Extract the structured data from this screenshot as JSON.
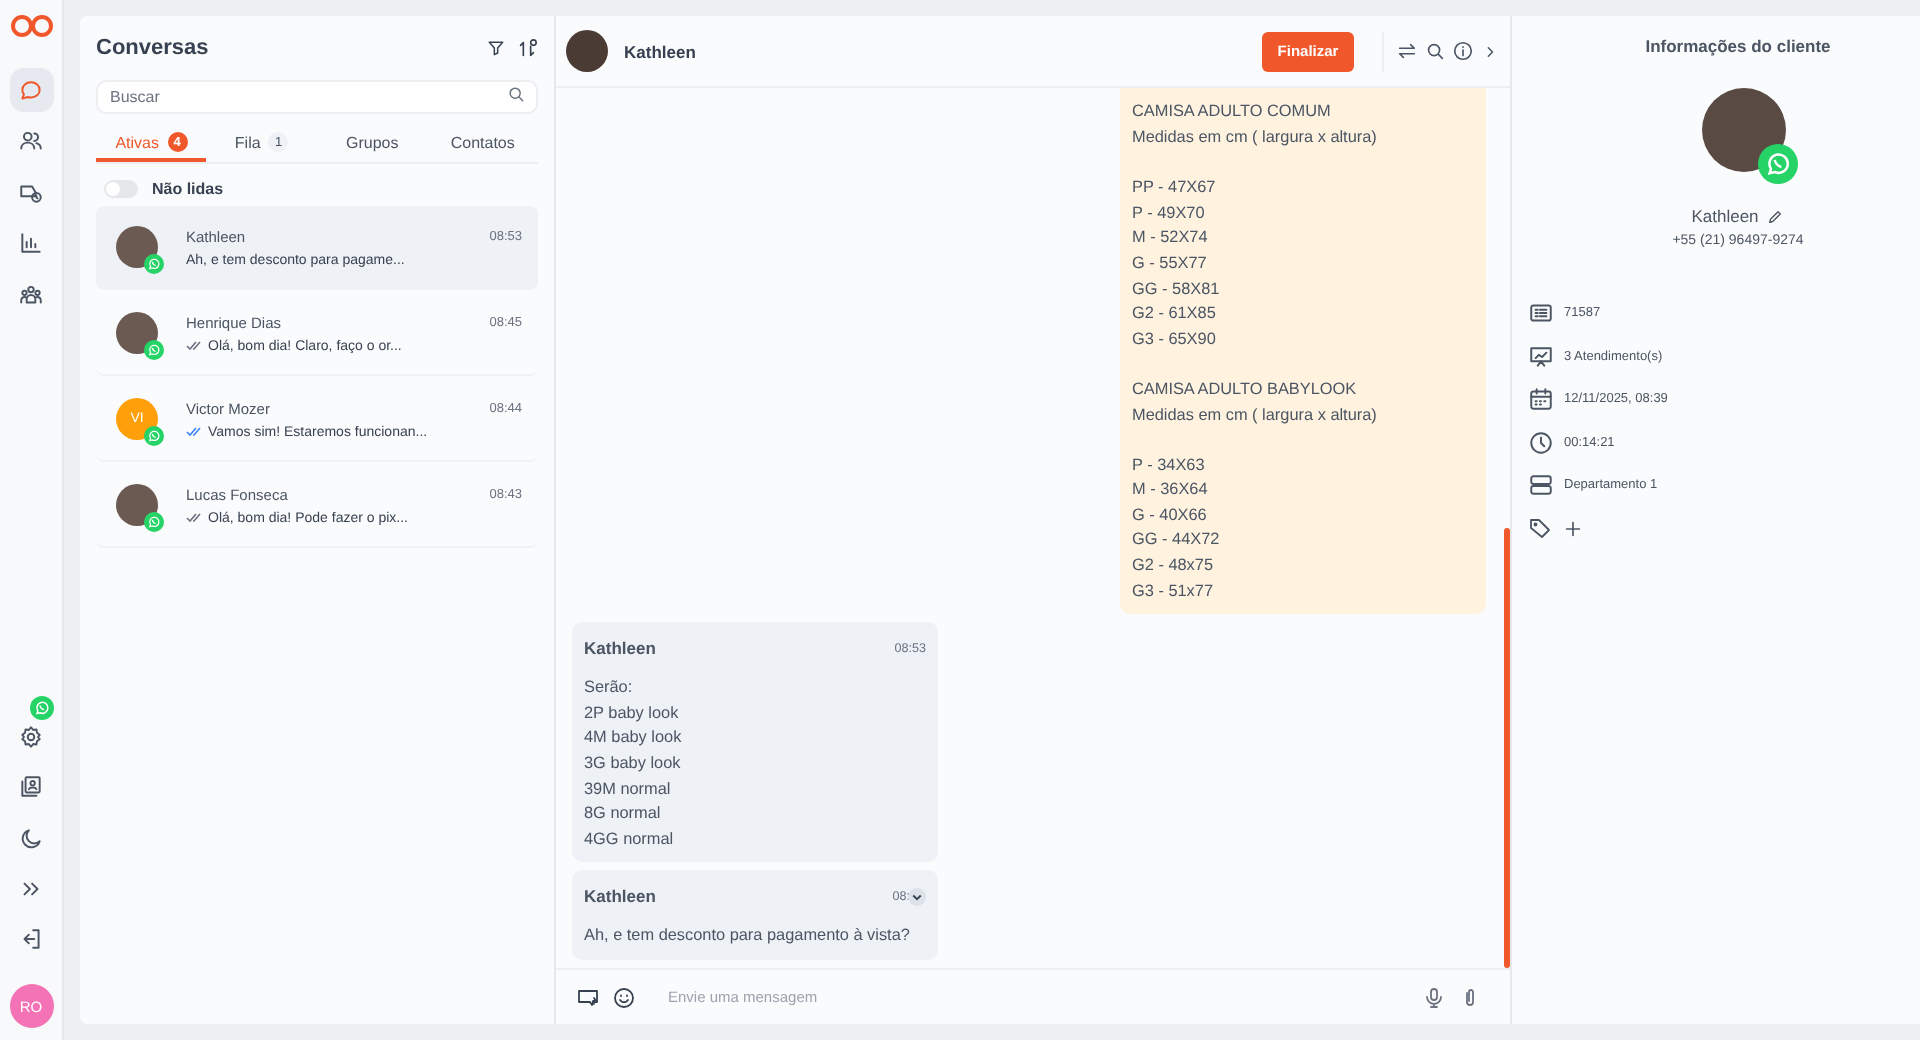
{
  "rail": {
    "items": [
      {
        "kind": "chat",
        "selected": true
      },
      {
        "kind": "contacts",
        "selected": false
      },
      {
        "kind": "queue",
        "selected": false
      },
      {
        "kind": "reports",
        "selected": false
      },
      {
        "kind": "teams",
        "selected": false
      }
    ],
    "bottom": [
      {
        "kind": "settings"
      },
      {
        "kind": "book"
      },
      {
        "kind": "moon"
      },
      {
        "kind": "expand"
      },
      {
        "kind": "logout"
      }
    ],
    "user_initials": "RO"
  },
  "conversations": {
    "title": "Conversas",
    "search": {
      "placeholder": "Buscar"
    },
    "tabs": [
      {
        "label": "Ativas",
        "count": "4",
        "selected": true
      },
      {
        "label": "Fila",
        "count": "1",
        "selected": false
      },
      {
        "label": "Grupos",
        "selected": false
      },
      {
        "label": "Contatos",
        "selected": false
      }
    ],
    "unread_filter": {
      "label": "Não lidas",
      "on": false
    },
    "items": [
      {
        "name": "Kathleen",
        "time": "08:53",
        "preview": "Ah, e tem desconto para pagame...",
        "kind": "photo",
        "delivered": false,
        "selected": true
      },
      {
        "name": "Henrique Dias",
        "time": "08:45",
        "preview": "Olá, bom dia! Claro, faço o or...",
        "kind": "photo",
        "delivered": true,
        "read": false,
        "selected": false
      },
      {
        "name": "Victor Mozer",
        "time": "08:44",
        "preview": "Vamos sim! Estaremos funcionan...",
        "kind": "initials",
        "initials": "VI",
        "delivered": true,
        "read": true,
        "selected": false
      },
      {
        "name": "Lucas Fonseca",
        "time": "08:43",
        "preview": "Olá, bom dia! Pode fazer o pix...",
        "kind": "photo",
        "delivered": true,
        "read": false,
        "selected": false
      }
    ]
  },
  "chat": {
    "contact": "Kathleen",
    "finish_button": "Finalizar",
    "messages": [
      {
        "kind": "outgoing",
        "text": "CAMISA ADULTO COMUM\nMedidas em cm ( largura x altura)\n\nPP - 47X67\nP - 49X70\nM - 52X74\nG - 55X77\nGG - 58X81\nG2 - 61X85\nG3 - 65X90\n\nCAMISA ADULTO BABYLOOK\nMedidas em cm ( largura x altura)\n\nP - 34X63\nM - 36X64\nG - 40X66\nGG - 44X72\nG2 - 48x75\nG3 - 51x77"
      },
      {
        "kind": "incoming",
        "sender": "Kathleen",
        "time": "08:53",
        "menu": false,
        "text": "Serão:\n2P baby look\n4M baby look\n3G baby look\n39M normal\n8G normal\n4GG normal"
      },
      {
        "kind": "incoming",
        "sender": "Kathleen",
        "time": "08:",
        "menu": true,
        "text": "Ah, e tem desconto para pagamento à vista?"
      }
    ],
    "composer": {
      "placeholder": "Envie uma mensagem"
    }
  },
  "client": {
    "title": "Informações do cliente",
    "name": "Kathleen",
    "phone": "+55 (21) 96497-9274",
    "details": [
      {
        "kind": "protocol",
        "text": "71587"
      },
      {
        "kind": "attendances",
        "text": "3 Atendimento(s)"
      },
      {
        "kind": "date",
        "text": "12/11/2025, 08:39"
      },
      {
        "kind": "duration",
        "text": "00:14:21"
      },
      {
        "kind": "department",
        "text": "Departamento 1"
      }
    ]
  }
}
